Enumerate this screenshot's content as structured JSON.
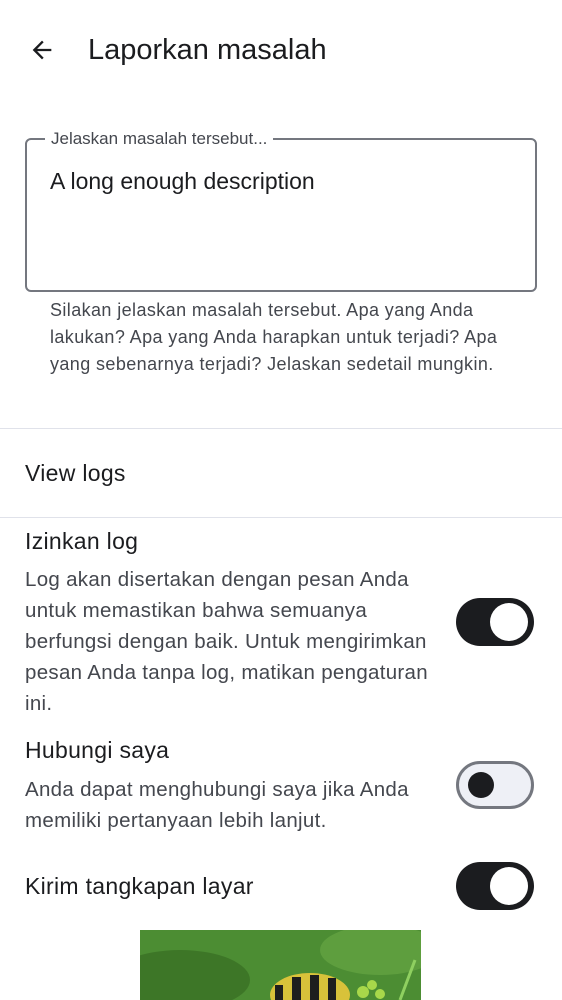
{
  "header": {
    "title": "Laporkan masalah",
    "back_icon": "arrow-back-icon"
  },
  "description_field": {
    "label": "Jelaskan masalah tersebut...",
    "value": "A long enough description",
    "help_text": "Silakan jelaskan masalah tersebut. Apa yang Anda lakukan? Apa yang Anda harapkan untuk terjadi? Apa yang sebenarnya terjadi? Jelaskan sedetail mungkin."
  },
  "view_logs": {
    "label": "View logs"
  },
  "settings": {
    "allow_logs": {
      "title": "Izinkan log",
      "description": "Log akan disertakan dengan pesan Anda untuk memastikan bahwa semuanya berfungsi dengan baik. Untuk mengirimkan pesan Anda tanpa log, matikan pengaturan ini.",
      "enabled": true
    },
    "contact_me": {
      "title": "Hubungi saya",
      "description": "Anda dapat menghubungi saya jika Anda memiliki pertanyaan lebih lanjut.",
      "enabled": false
    },
    "send_screenshot": {
      "title": "Kirim tangkapan layar",
      "enabled": true
    }
  },
  "colors": {
    "switch_on": "#1b1c1f",
    "switch_off_track": "#eef0f6",
    "outline": "#74777f"
  }
}
